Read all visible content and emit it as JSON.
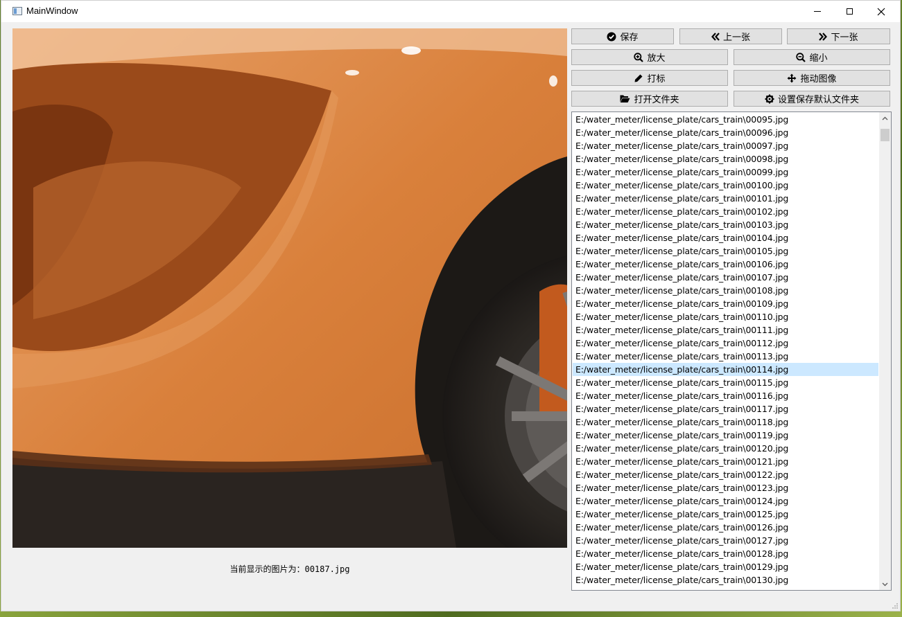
{
  "window": {
    "title": "MainWindow"
  },
  "toolbar": {
    "save": "保存",
    "prev": "上一张",
    "next": "下一张",
    "zoom_in": "放大",
    "zoom_out": "缩小",
    "annotate": "打标",
    "drag": "拖动图像",
    "open_folder": "打开文件夹",
    "set_default_folder": "设置保存默认文件夹"
  },
  "status": {
    "current_image_text": "当前显示的图片为：00187.jpg"
  },
  "file_list": {
    "selected_index": 19,
    "items": [
      "E:/water_meter/license_plate/cars_train\\00095.jpg",
      "E:/water_meter/license_plate/cars_train\\00096.jpg",
      "E:/water_meter/license_plate/cars_train\\00097.jpg",
      "E:/water_meter/license_plate/cars_train\\00098.jpg",
      "E:/water_meter/license_plate/cars_train\\00099.jpg",
      "E:/water_meter/license_plate/cars_train\\00100.jpg",
      "E:/water_meter/license_plate/cars_train\\00101.jpg",
      "E:/water_meter/license_plate/cars_train\\00102.jpg",
      "E:/water_meter/license_plate/cars_train\\00103.jpg",
      "E:/water_meter/license_plate/cars_train\\00104.jpg",
      "E:/water_meter/license_plate/cars_train\\00105.jpg",
      "E:/water_meter/license_plate/cars_train\\00106.jpg",
      "E:/water_meter/license_plate/cars_train\\00107.jpg",
      "E:/water_meter/license_plate/cars_train\\00108.jpg",
      "E:/water_meter/license_plate/cars_train\\00109.jpg",
      "E:/water_meter/license_plate/cars_train\\00110.jpg",
      "E:/water_meter/license_plate/cars_train\\00111.jpg",
      "E:/water_meter/license_plate/cars_train\\00112.jpg",
      "E:/water_meter/license_plate/cars_train\\00113.jpg",
      "E:/water_meter/license_plate/cars_train\\00114.jpg",
      "E:/water_meter/license_plate/cars_train\\00115.jpg",
      "E:/water_meter/license_plate/cars_train\\00116.jpg",
      "E:/water_meter/license_plate/cars_train\\00117.jpg",
      "E:/water_meter/license_plate/cars_train\\00118.jpg",
      "E:/water_meter/license_plate/cars_train\\00119.jpg",
      "E:/water_meter/license_plate/cars_train\\00120.jpg",
      "E:/water_meter/license_plate/cars_train\\00121.jpg",
      "E:/water_meter/license_plate/cars_train\\00122.jpg",
      "E:/water_meter/license_plate/cars_train\\00123.jpg",
      "E:/water_meter/license_plate/cars_train\\00124.jpg",
      "E:/water_meter/license_plate/cars_train\\00125.jpg",
      "E:/water_meter/license_plate/cars_train\\00126.jpg",
      "E:/water_meter/license_plate/cars_train\\00127.jpg",
      "E:/water_meter/license_plate/cars_train\\00128.jpg",
      "E:/water_meter/license_plate/cars_train\\00129.jpg",
      "E:/water_meter/license_plate/cars_train\\00130.jpg"
    ]
  },
  "icons": {
    "save": "check-circle-icon",
    "prev": "double-chevron-left-icon",
    "next": "double-chevron-right-icon",
    "zoom_in": "zoom-in-icon",
    "zoom_out": "zoom-out-icon",
    "annotate": "pen-icon",
    "drag": "move-arrows-icon",
    "open_folder": "folder-open-icon",
    "set_default_folder": "gear-icon"
  },
  "colors": {
    "selection": "#cce8ff",
    "car_body": "#d9803b"
  }
}
